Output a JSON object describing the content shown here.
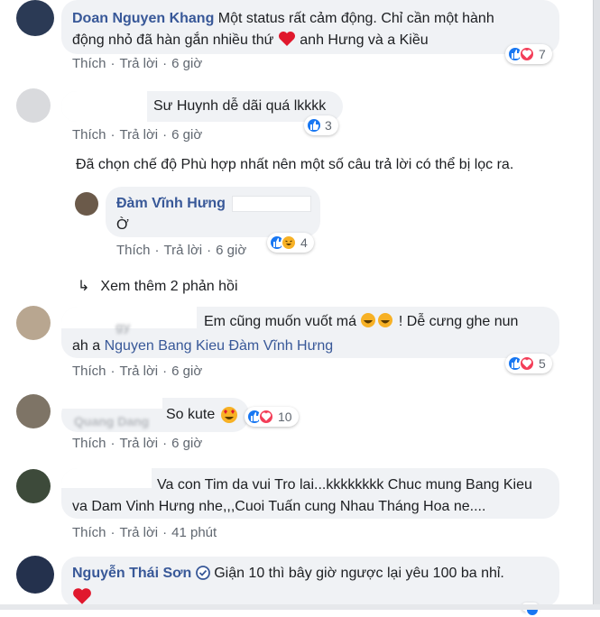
{
  "comments": [
    {
      "author": "Doan Nguyen Khang",
      "text": "Một status rất cảm động. Chỉ cần một hành",
      "text2": "động nhỏ đã hàn gắn nhiều thứ",
      "text3": "anh Hưng và a Kiều",
      "like": "Thích",
      "reply": "Trả lời",
      "time": "6 giờ",
      "reactions": "7"
    },
    {
      "text": "Sư Huynh dễ dãi quá lkkkk",
      "like": "Thích",
      "reply": "Trả lời",
      "time": "6 giờ",
      "reactions": "3"
    },
    {
      "author": "Đàm Vĩnh Hưng",
      "text": "Ờ",
      "like": "Thích",
      "reply": "Trả lời",
      "time": "6 giờ",
      "reactions": "4"
    },
    {
      "text": "Em cũng muốn vuốt má",
      "text_b": "! Dễ cưng ghe nun",
      "prefix": "ah a",
      "mention": "Nguyen Bang Kieu Đàm Vĩnh Hưng",
      "like": "Thích",
      "reply": "Trả lời",
      "time": "6 giờ",
      "reactions": "5"
    },
    {
      "text": "So kute",
      "like": "Thích",
      "reply": "Trả lời",
      "time": "6 giờ",
      "reactions": "10"
    },
    {
      "text": "Va con Tim da vui Tro lai...kkkkkkkk Chuc mung Bang Kieu",
      "text2": "va Dam Vinh Hưng nhe,,,Cuoi Tuấn cung Nhau Tháng Hoa ne....",
      "like": "Thích",
      "reply": "Trả lời",
      "time": "41 phút"
    },
    {
      "author": "Nguyễn Thái Sơn",
      "text": "Giận 10 thì bây giờ ngược lại yêu 100 ba nhỉ."
    }
  ],
  "filter_note": "Đã chọn chế độ Phù hợp nhất nên một số câu trả lời có thể bị lọc ra.",
  "view_more": "Xem thêm 2 phản hồi",
  "colors": {
    "like": "#1877f2",
    "love": "#f33e58",
    "haha": "#f7b125",
    "name": "#385898",
    "bubble": "#f0f2f5"
  }
}
